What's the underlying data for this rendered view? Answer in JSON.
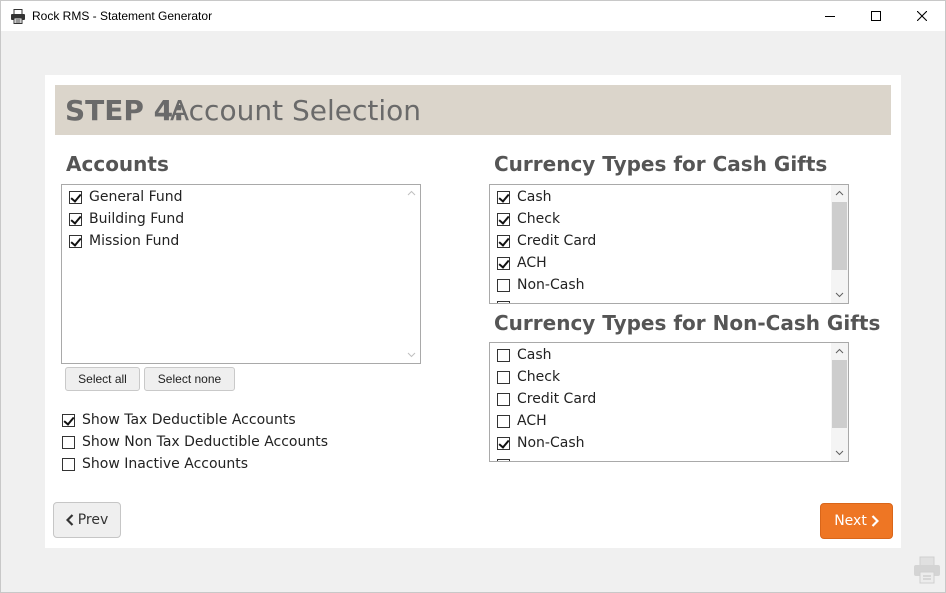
{
  "window": {
    "title": "Rock RMS - Statement Generator"
  },
  "step": {
    "number": "STEP 4:",
    "title": "Account Selection"
  },
  "accounts": {
    "title": "Accounts",
    "items": [
      {
        "label": "General Fund",
        "checked": true
      },
      {
        "label": "Building Fund",
        "checked": true
      },
      {
        "label": "Mission Fund",
        "checked": true
      }
    ],
    "select_all_label": "Select all",
    "select_none_label": "Select none"
  },
  "options": [
    {
      "label": "Show Tax Deductible Accounts",
      "checked": true
    },
    {
      "label": "Show Non Tax Deductible Accounts",
      "checked": false
    },
    {
      "label": "Show Inactive Accounts",
      "checked": false
    }
  ],
  "cash_gifts": {
    "title": "Currency Types for Cash Gifts",
    "items": [
      {
        "label": "Cash",
        "checked": true
      },
      {
        "label": "Check",
        "checked": true
      },
      {
        "label": "Credit Card",
        "checked": true
      },
      {
        "label": "ACH",
        "checked": true
      },
      {
        "label": "Non-Cash",
        "checked": false
      }
    ]
  },
  "noncash_gifts": {
    "title": "Currency Types for Non-Cash Gifts",
    "items": [
      {
        "label": "Cash",
        "checked": false
      },
      {
        "label": "Check",
        "checked": false
      },
      {
        "label": "Credit Card",
        "checked": false
      },
      {
        "label": "ACH",
        "checked": false
      },
      {
        "label": "Non-Cash",
        "checked": true
      }
    ]
  },
  "navigation": {
    "prev_label": "Prev",
    "next_label": "Next"
  },
  "colors": {
    "header_bg": "#dbd5cb",
    "accent": "#ee7624"
  }
}
